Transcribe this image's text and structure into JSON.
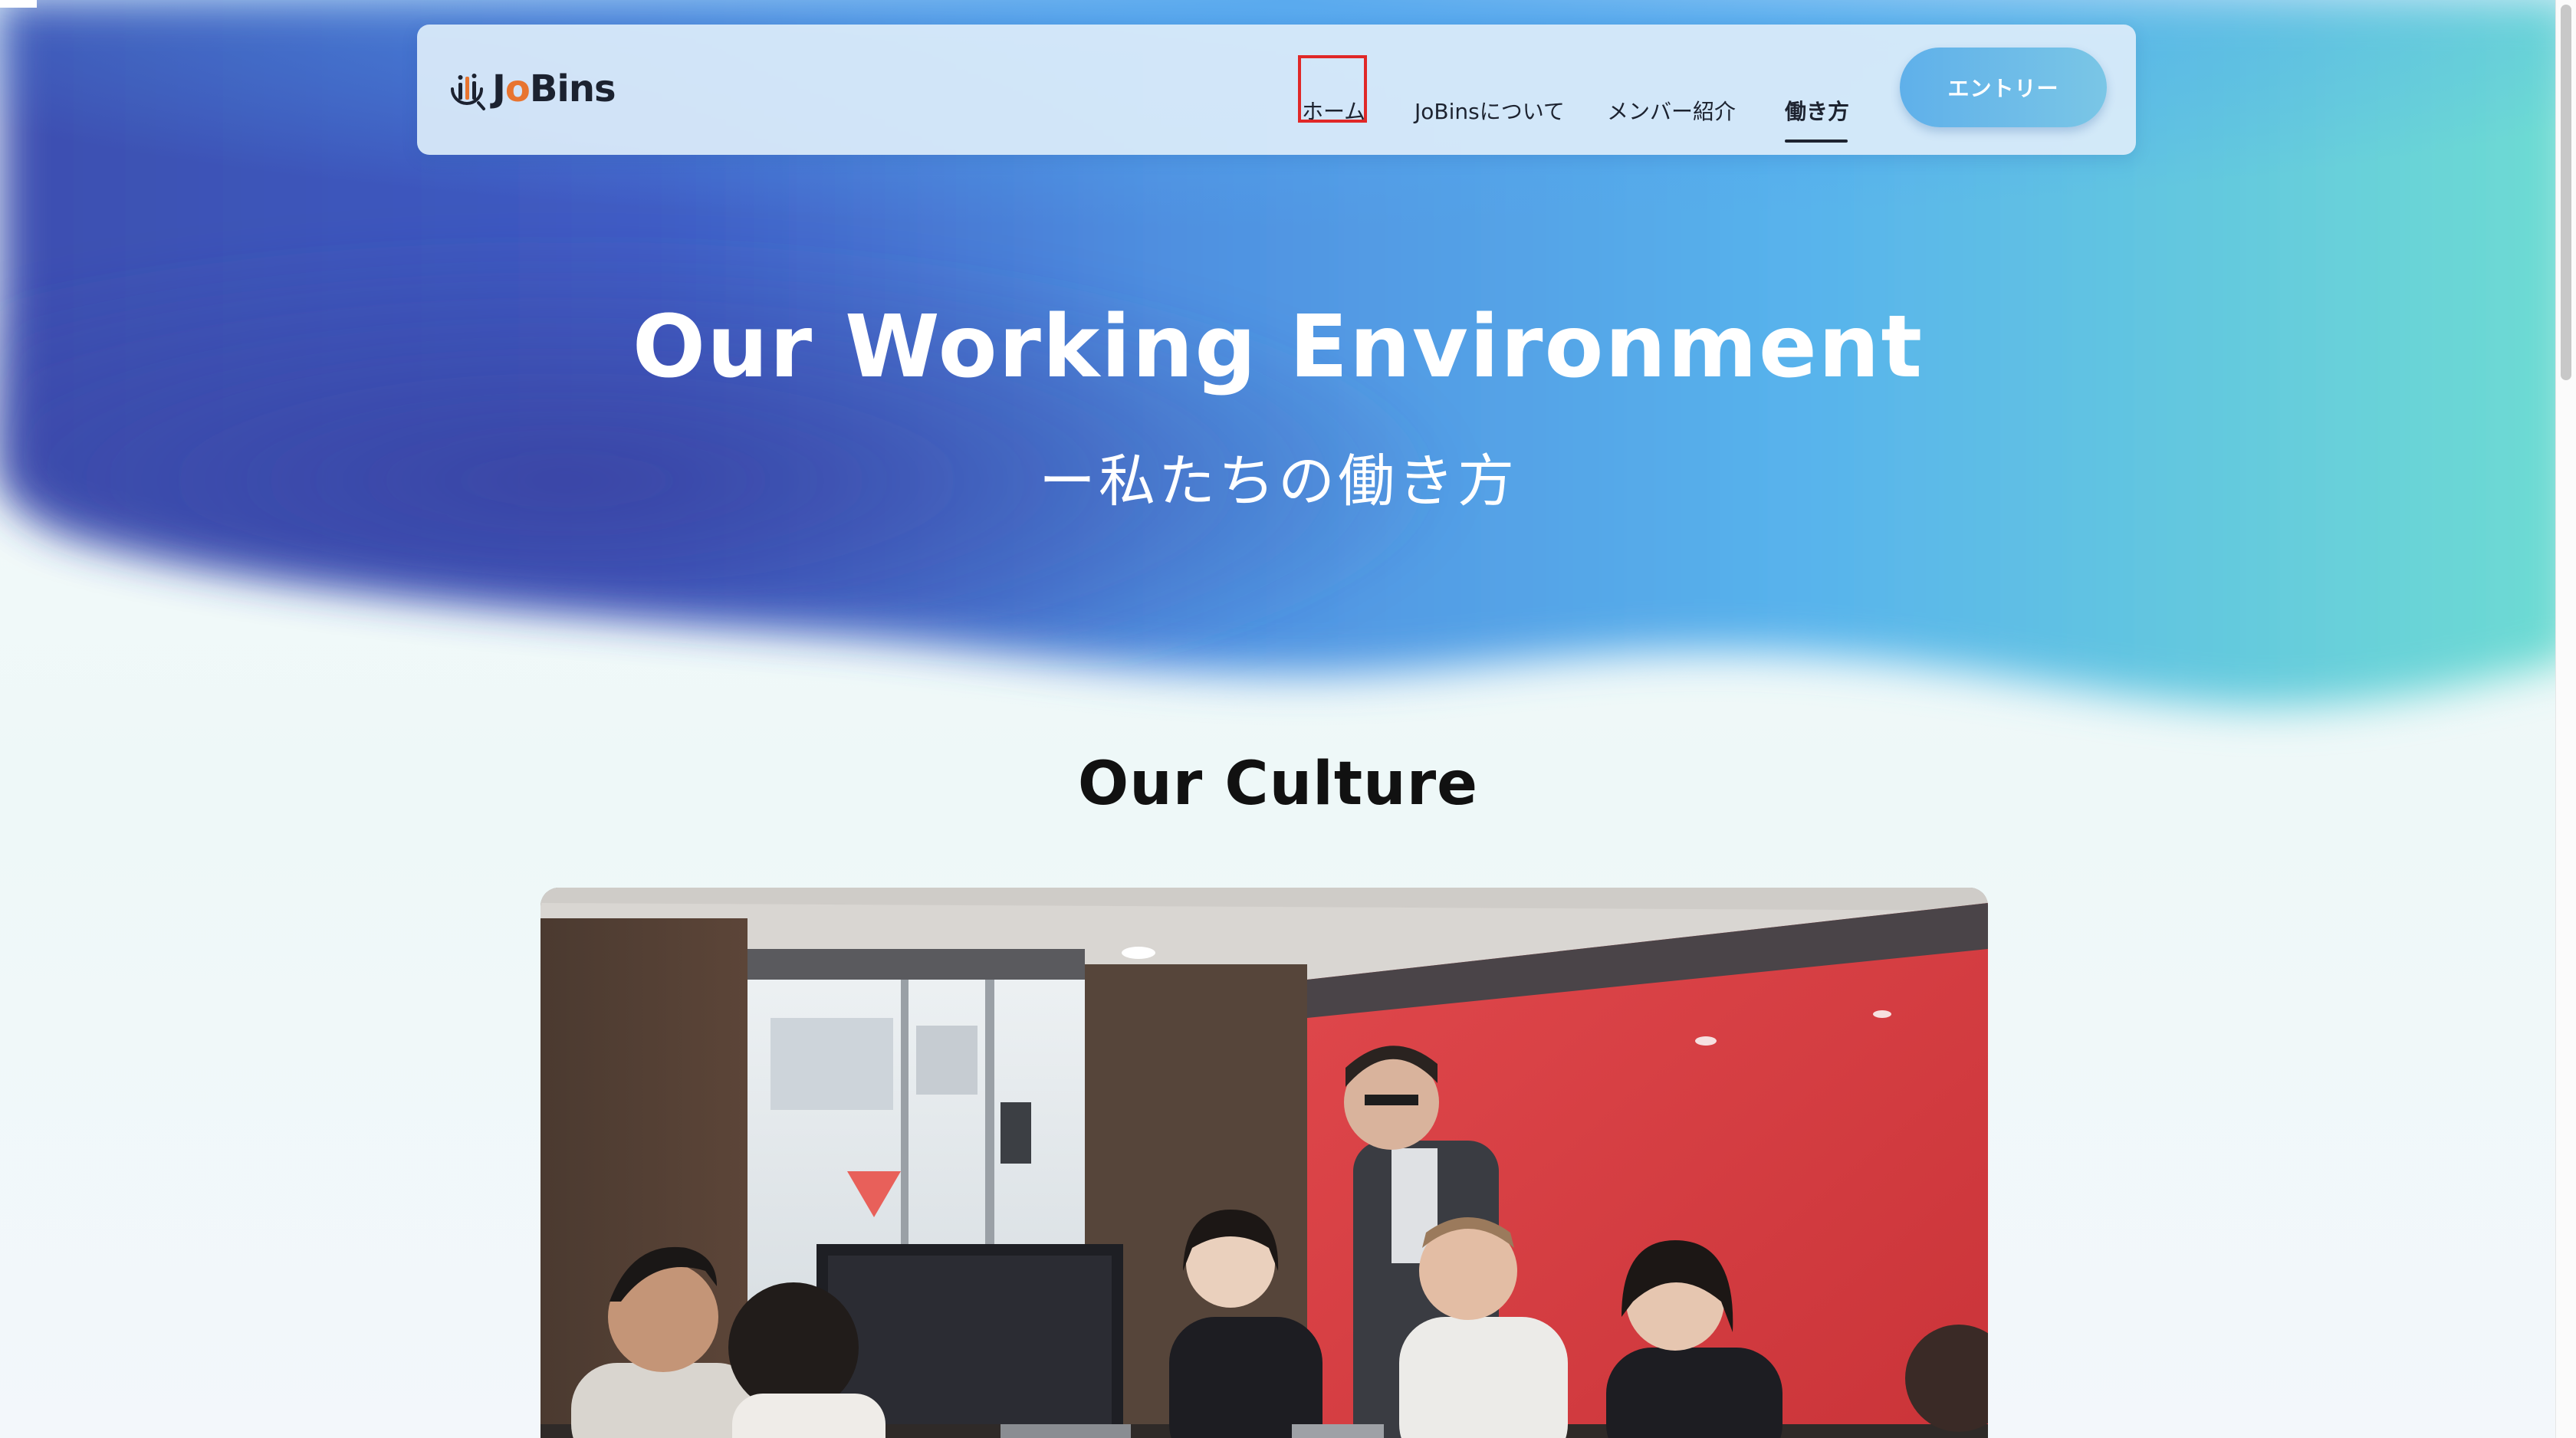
{
  "brand": {
    "logo_text_pre": "J",
    "logo_text_o": "o",
    "logo_text_post": "Bins"
  },
  "nav": {
    "items": [
      {
        "label": "ホーム",
        "highlighted": true
      },
      {
        "label": "JoBinsについて"
      },
      {
        "label": "メンバー紹介"
      },
      {
        "label": "働き方",
        "active": true
      }
    ],
    "entry_label": "エントリー"
  },
  "hero": {
    "title": "Our Working Environment",
    "subtitle": "ー私たちの働き方"
  },
  "culture": {
    "title": "Our Culture",
    "photo_icon": "office-meeting-photo"
  },
  "colors": {
    "accent": "#5fb0ea",
    "logo_orange": "#e8742f",
    "highlight_box": "#e02828"
  }
}
